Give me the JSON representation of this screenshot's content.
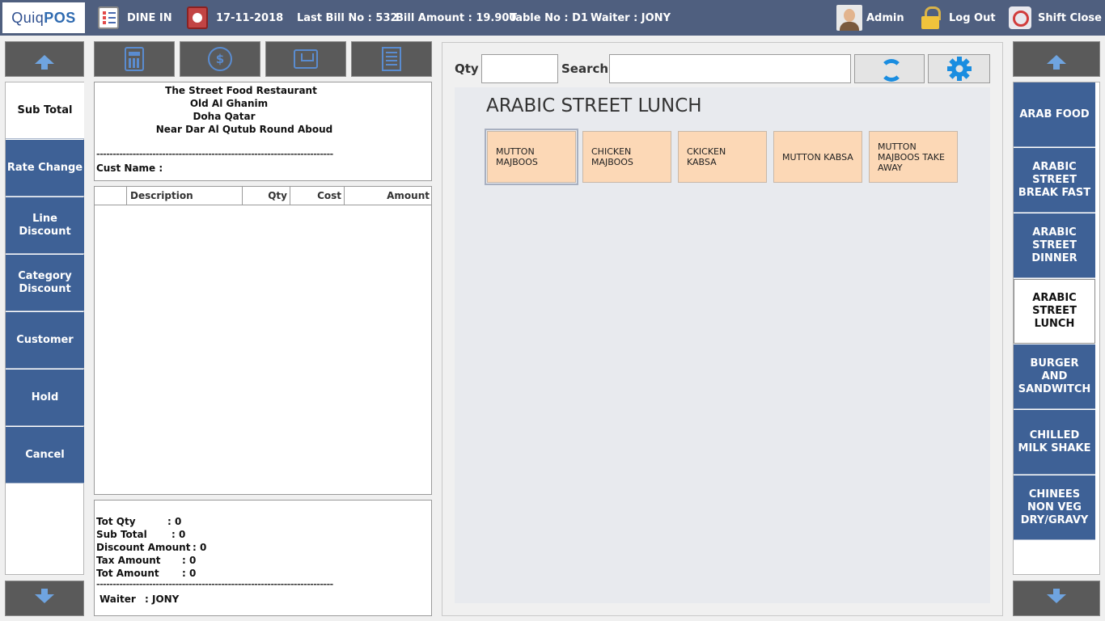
{
  "header": {
    "logo_text_a": "Quiq",
    "logo_text_b": "POS",
    "mode": "DINE IN",
    "date": "17-11-2018",
    "last_bill": "Last Bill No : 532",
    "bill_amount": "Bill Amount : 19.900",
    "table_no": "Table No : D1",
    "waiter": "Waiter : JONY",
    "user": "Admin",
    "logout": "Log Out",
    "shift_close": "Shift Close"
  },
  "left_actions": [
    "Sub Total",
    "Rate Change",
    "Line Discount",
    "Category Discount",
    "Customer",
    "Hold",
    "Cancel"
  ],
  "receipt": {
    "restaurant_name": "The Street Food Restaurant",
    "address_1": "Old Al Ghanim",
    "address_2": "Doha Qatar",
    "address_3": "Near Dar Al Qutub Round Aboud",
    "separator": "------------------------------------------------------------------------",
    "cust_name_label": "Cust Name :",
    "columns": [
      "Description",
      "Qty",
      "Cost",
      "Amount"
    ],
    "totals": [
      {
        "label": "Tot Qty",
        "value": ": 0"
      },
      {
        "label": "Sub Total",
        "value": ": 0"
      },
      {
        "label": "Discount Amount",
        "value": ": 0"
      },
      {
        "label": "Tax Amount",
        "value": ": 0"
      },
      {
        "label": "Tot Amount",
        "value": ": 0"
      }
    ],
    "waiter_label": "Waiter",
    "waiter_value": ": JONY"
  },
  "search": {
    "qty_label": "Qty",
    "qty_value": "",
    "search_label": "Search",
    "search_value": ""
  },
  "category_title": "ARABIC STREET LUNCH",
  "items": [
    "MUTTON MAJBOOS",
    "CHICKEN MAJBOOS",
    "CKICKEN KABSA",
    "MUTTON KABSA",
    "MUTTON MAJBOOS TAKE AWAY"
  ],
  "categories": [
    "ARAB FOOD",
    "ARABIC STREET BREAK FAST",
    "ARABIC STREET DINNER",
    "ARABIC STREET LUNCH",
    "BURGER AND SANDWITCH",
    "CHILLED MILK SHAKE",
    "CHINEES NON VEG DRY/GRAVY"
  ],
  "colors": {
    "topbar": "#4f5f7f",
    "button_blue": "#3e6196",
    "item_tile": "#fcd8b6",
    "icon_blue": "#1a8de0"
  }
}
